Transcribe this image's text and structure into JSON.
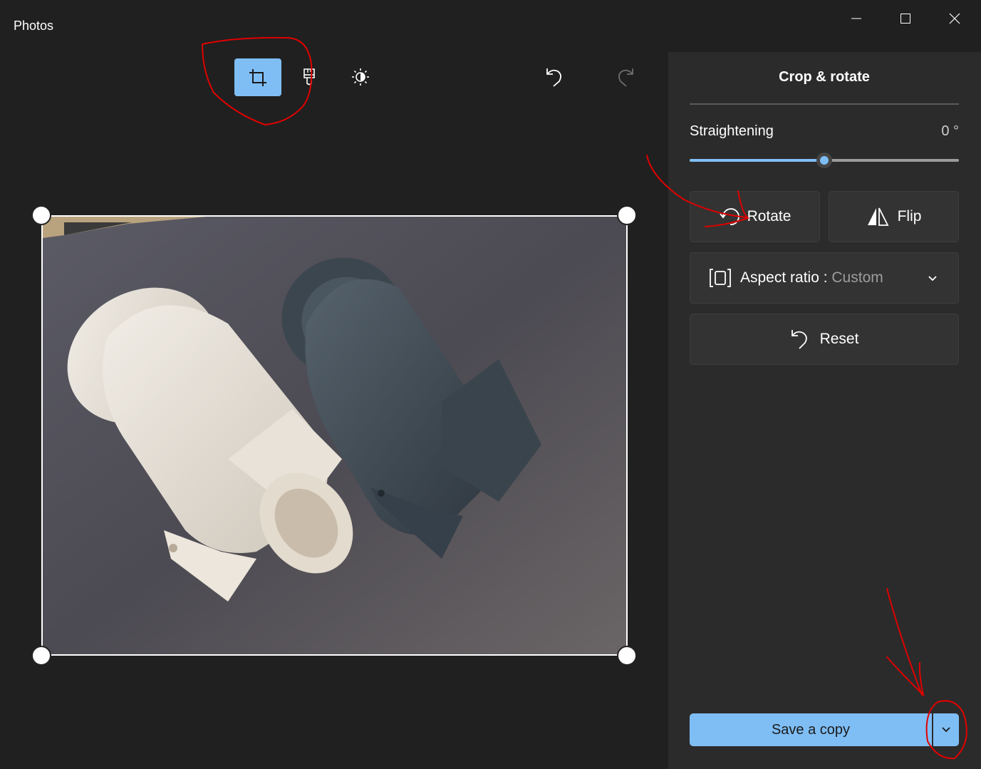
{
  "window": {
    "title": "Photos",
    "controls": [
      "minimize-icon",
      "maximize-icon",
      "close-icon"
    ]
  },
  "toolbar": {
    "tools": [
      {
        "name": "crop-icon",
        "active": true
      },
      {
        "name": "markup-brush-icon",
        "active": false
      },
      {
        "name": "adjust-brightness-icon",
        "active": false
      }
    ],
    "undo_icon": "undo-icon",
    "redo_icon": "redo-icon",
    "redo_enabled": false
  },
  "panel": {
    "title": "Crop & rotate",
    "straightening": {
      "label": "Straightening",
      "value": "0 °",
      "level": 0.5
    },
    "rotate_label": "Rotate",
    "flip_label": "Flip",
    "aspect_ratio": {
      "label": "Aspect ratio : ",
      "value": "Custom"
    },
    "reset_label": "Reset",
    "save_label": "Save a copy"
  },
  "colors": {
    "accent": "#7fbef5",
    "panel_bg": "#2b2b2b",
    "canvas_bg": "#202020",
    "annotation": "#e00000"
  }
}
